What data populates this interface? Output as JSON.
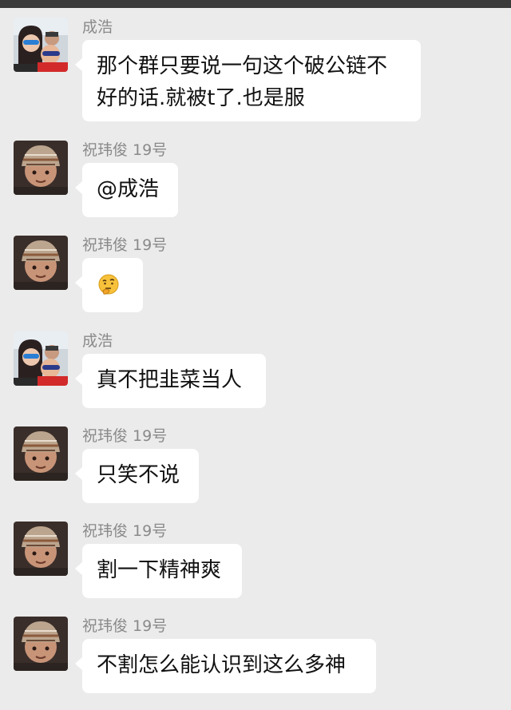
{
  "messages": [
    {
      "sender": "成浩",
      "text": "那个群只要说一句这个破公链不好的话.就被t了.也是服",
      "avatar": "couple-photo-avatar"
    },
    {
      "sender": "祝玮俊 19号",
      "text": "@成浩",
      "avatar": "knit-hat-kid-avatar"
    },
    {
      "sender": "祝玮俊 19号",
      "text": "",
      "emoji": "thinking-face-icon",
      "avatar": "knit-hat-kid-avatar"
    },
    {
      "sender": "成浩",
      "text": "真不把韭菜当人",
      "avatar": "couple-photo-avatar"
    },
    {
      "sender": "祝玮俊 19号",
      "text": "只笑不说",
      "avatar": "knit-hat-kid-avatar"
    },
    {
      "sender": "祝玮俊 19号",
      "text": "割一下精神爽",
      "avatar": "knit-hat-kid-avatar"
    },
    {
      "sender": "祝玮俊 19号",
      "text": "不割怎么能认识到这么多神",
      "avatar": "knit-hat-kid-avatar"
    }
  ],
  "colors": {
    "background": "#ebebeb",
    "bubble": "#ffffff",
    "sender_text": "#8a8a8a",
    "status_bar": "#3a3a3a"
  }
}
